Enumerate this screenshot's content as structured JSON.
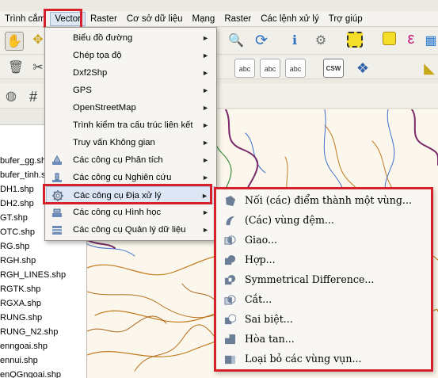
{
  "menubar": {
    "items": [
      {
        "label": "Trình cắm"
      },
      {
        "label": "Vector"
      },
      {
        "label": "Raster"
      },
      {
        "label": "Cơ sở dữ liệu"
      },
      {
        "label": "Mạng"
      },
      {
        "label": "Raster"
      },
      {
        "label": "Các lệnh xử lý"
      },
      {
        "label": "Trợ giúp"
      }
    ]
  },
  "vector_menu": {
    "items": [
      {
        "label": "Biểu đồ đường",
        "icon": "none"
      },
      {
        "label": "Chép tọa độ",
        "icon": "none"
      },
      {
        "label": "Dxf2Shp",
        "icon": "none"
      },
      {
        "label": "GPS",
        "icon": "none"
      },
      {
        "label": "OpenStreetMap",
        "icon": "none"
      },
      {
        "label": "Trình kiểm tra cấu trúc liên kết",
        "icon": "none"
      },
      {
        "label": "Truy vấn Không gian",
        "icon": "none"
      },
      {
        "label": "Các công cụ Phân tích",
        "icon": "analysis-tools-icon"
      },
      {
        "label": "Các công cụ Nghiên cứu",
        "icon": "research-tools-icon"
      },
      {
        "label": "Các công cụ Địa xử lý",
        "icon": "geoprocessing-gear-icon"
      },
      {
        "label": "Các công cụ Hình học",
        "icon": "geometry-tools-icon"
      },
      {
        "label": "Các công cụ Quản lý dữ liệu",
        "icon": "data-management-icon"
      }
    ]
  },
  "submenu": {
    "items": [
      {
        "label": "Nối (các) điểm thành một vùng...",
        "icon": "convex-hull-icon"
      },
      {
        "label": "(Các) vùng đệm...",
        "icon": "buffer-icon"
      },
      {
        "label": "Giao...",
        "icon": "intersect-icon"
      },
      {
        "label": "Hợp...",
        "icon": "union-icon"
      },
      {
        "label": "Symmetrical Difference...",
        "icon": "sym-difference-icon"
      },
      {
        "label": "Cắt...",
        "icon": "clip-icon"
      },
      {
        "label": "Sai biệt...",
        "icon": "difference-icon"
      },
      {
        "label": "Hòa tan...",
        "icon": "dissolve-icon"
      },
      {
        "label": "Loại bỏ các vùng vụn...",
        "icon": "eliminate-slivers-icon"
      }
    ]
  },
  "layers": {
    "items": [
      {
        "label": "bufer_gg.shp"
      },
      {
        "label": "bufer_tinh.shp"
      },
      {
        "label": "DH1.shp"
      },
      {
        "label": "DH2.shp"
      },
      {
        "label": "GT.shp"
      },
      {
        "label": "OTC.shp"
      },
      {
        "label": "RG.shp"
      },
      {
        "label": "RGH.shp"
      },
      {
        "label": "RGH_LINES.shp"
      },
      {
        "label": "RGTK.shp"
      },
      {
        "label": "RGXA.shp"
      },
      {
        "label": "RUNG.shp"
      },
      {
        "label": "RUNG_N2.shp"
      },
      {
        "label": "enngoai.shp"
      },
      {
        "label": "ennui.shp"
      },
      {
        "label": "enQGngoai.shp"
      }
    ]
  },
  "toolbar": {
    "csw_label": "CSW",
    "abc_label": "abc"
  },
  "colors": {
    "highlight_red": "#d6202a",
    "map_bg": "#fbf7ec",
    "boundary_purple": "#7a2a6a",
    "river_blue": "#3f6fd0",
    "road_orange": "#c47a1e",
    "forest_green": "#3c8b3c"
  }
}
